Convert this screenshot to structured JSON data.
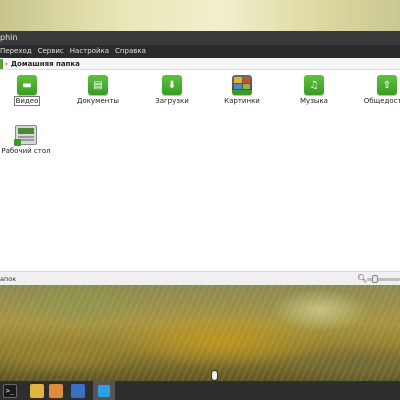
{
  "window": {
    "title": "phin"
  },
  "menu": [
    "Переход",
    "Сервис",
    "Настройка",
    "Справка"
  ],
  "location": {
    "arrow": "›",
    "label": "Домашняя папка"
  },
  "files": [
    {
      "label": "Видео",
      "icon": "video-folder-icon",
      "selected": true
    },
    {
      "label": "Документы",
      "icon": "documents-folder-icon"
    },
    {
      "label": "Загрузки",
      "icon": "downloads-folder-icon"
    },
    {
      "label": "Картинки",
      "icon": "pictures-folder-icon"
    },
    {
      "label": "Музыка",
      "icon": "music-folder-icon"
    },
    {
      "label": "Общедоступ",
      "icon": "public-folder-icon"
    },
    {
      "label": "Рабочий стол",
      "icon": "desktop-folder-icon"
    }
  ],
  "status": {
    "text": "апок"
  },
  "colors": {
    "folder_green": "#4caf32",
    "titlebar": "#3a3a3a",
    "menubar": "#2b2b2b",
    "taskbar": "#2e2e2e"
  },
  "glyphs": {
    "video": "▬",
    "documents": "▤",
    "downloads": "⬇",
    "music": "♫",
    "public": "⇧",
    "zoom": "🔍︎",
    "terminal": ">_"
  }
}
